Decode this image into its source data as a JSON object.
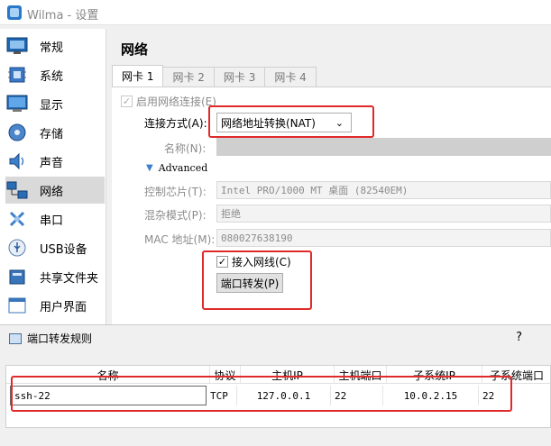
{
  "window": {
    "title": "Wilma - 设置"
  },
  "sidebar": {
    "items": [
      {
        "label": "常规",
        "icon": "general-icon"
      },
      {
        "label": "系统",
        "icon": "system-icon"
      },
      {
        "label": "显示",
        "icon": "display-icon"
      },
      {
        "label": "存储",
        "icon": "storage-icon"
      },
      {
        "label": "声音",
        "icon": "audio-icon"
      },
      {
        "label": "网络",
        "icon": "network-icon",
        "selected": true
      },
      {
        "label": "串口",
        "icon": "serial-port-icon"
      },
      {
        "label": "USB设备",
        "icon": "usb-icon"
      },
      {
        "label": "共享文件夹",
        "icon": "shared-folder-icon"
      },
      {
        "label": "用户界面",
        "icon": "user-interface-icon"
      }
    ]
  },
  "panel": {
    "title": "网络",
    "tabs": [
      {
        "label": "网卡 1",
        "active": true
      },
      {
        "label": "网卡 2"
      },
      {
        "label": "网卡 3"
      },
      {
        "label": "网卡 4"
      }
    ],
    "enable_label": "启用网络连接(E)",
    "attach_label": "连接方式(A):",
    "attach_value": "网络地址转换(NAT)",
    "name_label": "名称(N):",
    "advanced_label": "Advanced",
    "adapter_label": "控制芯片(T):",
    "adapter_value": "Intel PRO/1000 MT 桌面 (82540EM)",
    "promisc_label": "混杂模式(P):",
    "promisc_value": "拒绝",
    "mac_label": "MAC 地址(M):",
    "mac_value": "080027638190",
    "cable_label": "接入网线(C)",
    "port_forward_button": "端口转发(P)"
  },
  "dialog": {
    "title": "端口转发规则",
    "help": "?",
    "columns": [
      "名称",
      "协议",
      "主机IP",
      "主机端口",
      "子系统IP",
      "子系统端口"
    ],
    "rows": [
      [
        "ssh-22",
        "TCP",
        "127.0.0.1",
        "22",
        "10.0.2.15",
        "22"
      ]
    ]
  },
  "colors": {
    "highlight": "#e02a2a",
    "selected": "#d9d9d9"
  }
}
